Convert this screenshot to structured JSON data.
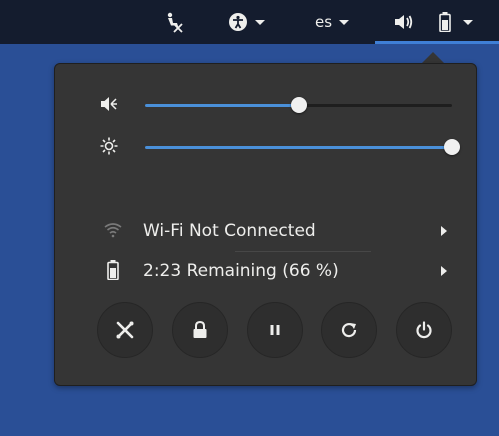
{
  "topbar": {
    "icons": [
      "accessibility-figure-icon",
      "volume-icon",
      "battery-icon"
    ],
    "language": "es"
  },
  "menu": {
    "volume": {
      "icon": "speaker-icon",
      "level": 0.5
    },
    "brightness": {
      "icon": "brightness-icon",
      "level": 1.0
    },
    "wifi": {
      "icon": "wifi-icon",
      "label": "Wi-Fi Not Connected"
    },
    "battery": {
      "icon": "battery-icon",
      "label": "2:23 Remaining (66 %)"
    },
    "actions": [
      "settings-icon",
      "lock-icon",
      "pause-icon",
      "refresh-icon",
      "power-icon"
    ]
  },
  "colors": {
    "panel": "#141c2e",
    "menu": "#353535",
    "accent": "#4a90d9",
    "desktop": "#2a4f96"
  }
}
